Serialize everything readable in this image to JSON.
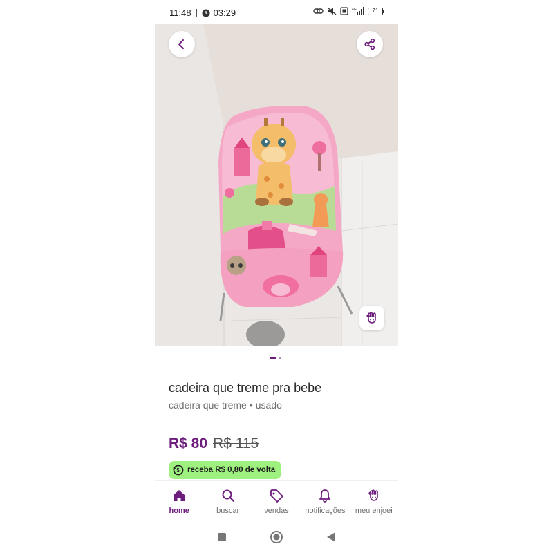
{
  "status_bar": {
    "time": "11:48",
    "timer": "03:29",
    "battery": "71"
  },
  "product": {
    "title": "cadeira que treme pra bebe",
    "subtitle_category": "cadeira que treme",
    "subtitle_separator": "•",
    "subtitle_condition": "usado",
    "price": "R$ 80",
    "old_price": "R$ 115",
    "cashback": "receba R$ 0,80 de volta",
    "photo_count": 2,
    "current_photo": 1
  },
  "nav": {
    "items": [
      {
        "label": "home",
        "icon": "home-icon"
      },
      {
        "label": "buscar",
        "icon": "search-icon"
      },
      {
        "label": "vendas",
        "icon": "tag-icon"
      },
      {
        "label": "notificações",
        "icon": "bell-icon"
      },
      {
        "label": "meu enjoei",
        "icon": "enjoei-hand-icon"
      }
    ]
  },
  "colors": {
    "accent": "#6d1d7c",
    "cashback_bg": "#9ef07f"
  }
}
